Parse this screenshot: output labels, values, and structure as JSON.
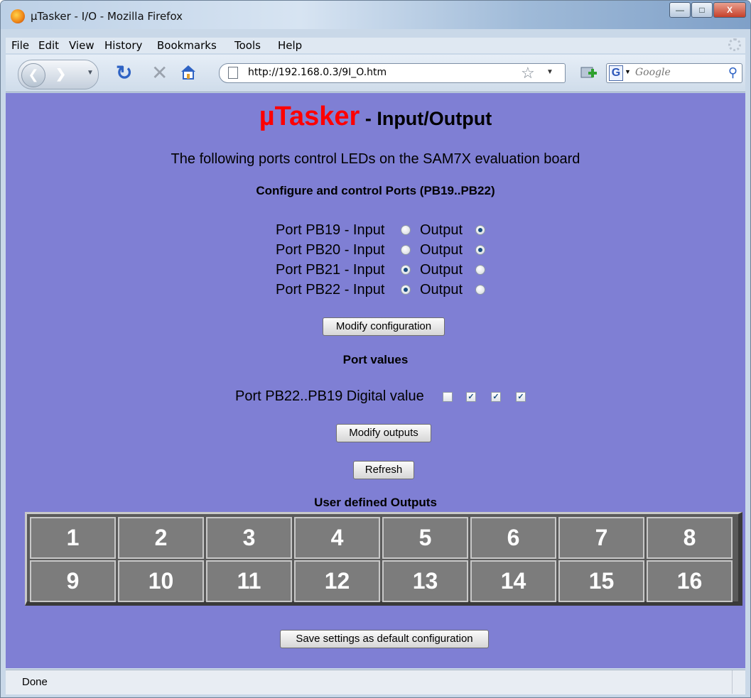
{
  "window": {
    "title": "µTasker - I/O - Mozilla Firefox"
  },
  "menu": [
    "File",
    "Edit",
    "View",
    "History",
    "Bookmarks",
    "Tools",
    "Help"
  ],
  "nav": {
    "url": "http://192.168.0.3/9I_O.htm",
    "search_placeholder": "Google"
  },
  "page": {
    "brand": "µTasker",
    "heading_rest": " - Input/Output",
    "intro": "The following ports control LEDs on the SAM7X evaluation board",
    "config_title": "Configure and control Ports (PB19..PB22)",
    "ports": [
      {
        "label": "Port PB19 - Input",
        "output_label": "Output",
        "mode": "output"
      },
      {
        "label": "Port PB20 - Input",
        "output_label": "Output",
        "mode": "output"
      },
      {
        "label": "Port PB21 - Input",
        "output_label": "Output",
        "mode": "input"
      },
      {
        "label": "Port PB22 - Input",
        "output_label": "Output",
        "mode": "input"
      }
    ],
    "modify_config_label": "Modify configuration",
    "values_title": "Port values",
    "digital_label": "Port PB22..PB19 Digital value",
    "digital_values": [
      false,
      true,
      true,
      true
    ],
    "modify_outputs_label": "Modify outputs",
    "refresh_label": "Refresh",
    "user_outputs_title": "User defined Outputs",
    "outputs": [
      "1",
      "2",
      "3",
      "4",
      "5",
      "6",
      "7",
      "8",
      "9",
      "10",
      "11",
      "12",
      "13",
      "14",
      "15",
      "16"
    ],
    "save_label": "Save settings as default configuration"
  },
  "status": {
    "text": "Done"
  },
  "colors": {
    "page_bg": "#7f7fd4",
    "brand": "#ff0000",
    "cell_bg": "#7c7c7c"
  }
}
